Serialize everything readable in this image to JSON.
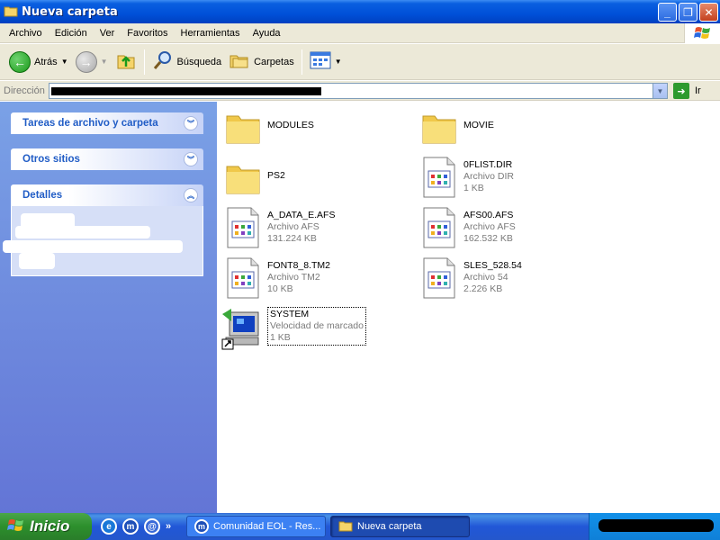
{
  "window": {
    "title": "Nueva carpeta",
    "minimize": "_",
    "maximize": "❐",
    "close": "✕"
  },
  "menu": [
    "Archivo",
    "Edición",
    "Ver",
    "Favoritos",
    "Herramientas",
    "Ayuda"
  ],
  "toolbar": {
    "back_label": "Atrás",
    "search_label": "Búsqueda",
    "folders_label": "Carpetas"
  },
  "address": {
    "label": "Dirección",
    "go_label": "Ir"
  },
  "sidebar": {
    "panels": [
      {
        "title": "Tareas de archivo y carpeta",
        "state": "collapsed"
      },
      {
        "title": "Otros sitios",
        "state": "collapsed"
      },
      {
        "title": "Detalles",
        "state": "expanded"
      }
    ]
  },
  "files": [
    {
      "name": "MODULES",
      "kind": "folder"
    },
    {
      "name": "MOVIE",
      "kind": "folder"
    },
    {
      "name": "PS2",
      "kind": "folder"
    },
    {
      "name": "0FLIST.DIR",
      "type": "Archivo DIR",
      "size": "1 KB",
      "kind": "file"
    },
    {
      "name": "A_DATA_E.AFS",
      "type": "Archivo AFS",
      "size": "131.224 KB",
      "kind": "file"
    },
    {
      "name": "AFS00.AFS",
      "type": "Archivo AFS",
      "size": "162.532 KB",
      "kind": "file"
    },
    {
      "name": "FONT8_8.TM2",
      "type": "Archivo TM2",
      "size": "10 KB",
      "kind": "file"
    },
    {
      "name": "SLES_528.54",
      "type": "Archivo 54",
      "size": "2.226 KB",
      "kind": "file"
    },
    {
      "name": "SYSTEM",
      "type": "Velocidad de marcado",
      "size": "1 KB",
      "kind": "shortcut",
      "selected": true
    }
  ],
  "taskbar": {
    "start_label": "Inicio",
    "quicklaunch_more": "»",
    "tasks": [
      {
        "label": "Comunidad EOL - Res..."
      },
      {
        "label": "Nueva carpeta",
        "active": true
      }
    ]
  },
  "colors": {
    "titlebar": "#0050d8",
    "sidebar": "#6f8fe0",
    "panel_title": "#215dc6",
    "taskbar": "#2457cc",
    "start_button": "#2c8f2c"
  }
}
